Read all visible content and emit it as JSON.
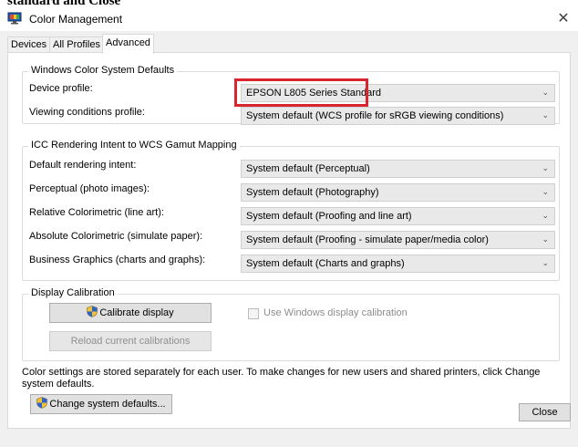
{
  "window": {
    "top_cut_text": "standard and Close",
    "title": "Color Management",
    "close_glyph": "✕"
  },
  "tabs": [
    {
      "label": "Devices",
      "active": false
    },
    {
      "label": "All Profiles",
      "active": false
    },
    {
      "label": "Advanced",
      "active": true
    }
  ],
  "wcs_defaults": {
    "legend": "Windows Color System Defaults",
    "device_profile_label": "Device profile:",
    "device_profile_value": "EPSON L805 Series Standard",
    "viewing_label": "Viewing conditions profile:",
    "viewing_value": "System default (WCS profile for sRGB viewing conditions)"
  },
  "icc_mapping": {
    "legend": "ICC Rendering Intent to WCS Gamut Mapping",
    "rows": [
      {
        "label": "Default rendering intent:",
        "value": "System default (Perceptual)"
      },
      {
        "label": "Perceptual (photo images):",
        "value": "System default (Photography)"
      },
      {
        "label": "Relative Colorimetric (line art):",
        "value": "System default (Proofing and line art)"
      },
      {
        "label": "Absolute Colorimetric (simulate paper):",
        "value": "System default (Proofing - simulate paper/media color)"
      },
      {
        "label": "Business Graphics (charts and graphs):",
        "value": "System default (Charts and graphs)"
      }
    ]
  },
  "calibration": {
    "legend": "Display Calibration",
    "calibrate_button": "Calibrate display",
    "use_windows_calibration": "Use Windows display calibration",
    "use_windows_calibration_checked": false,
    "reload_button": "Reload current calibrations"
  },
  "footer": {
    "note": "Color settings are stored separately for each user. To make changes for new users and shared printers, click Change system defaults.",
    "change_defaults_button": "Change system defaults...",
    "close_button": "Close"
  },
  "colors": {
    "highlight_border": "#d9262e",
    "dialog_background": "#f0f0f0"
  },
  "icons": {
    "app": "color-management-icon",
    "shield": "uac-shield-icon",
    "dropdown": "chevron-down-icon"
  }
}
